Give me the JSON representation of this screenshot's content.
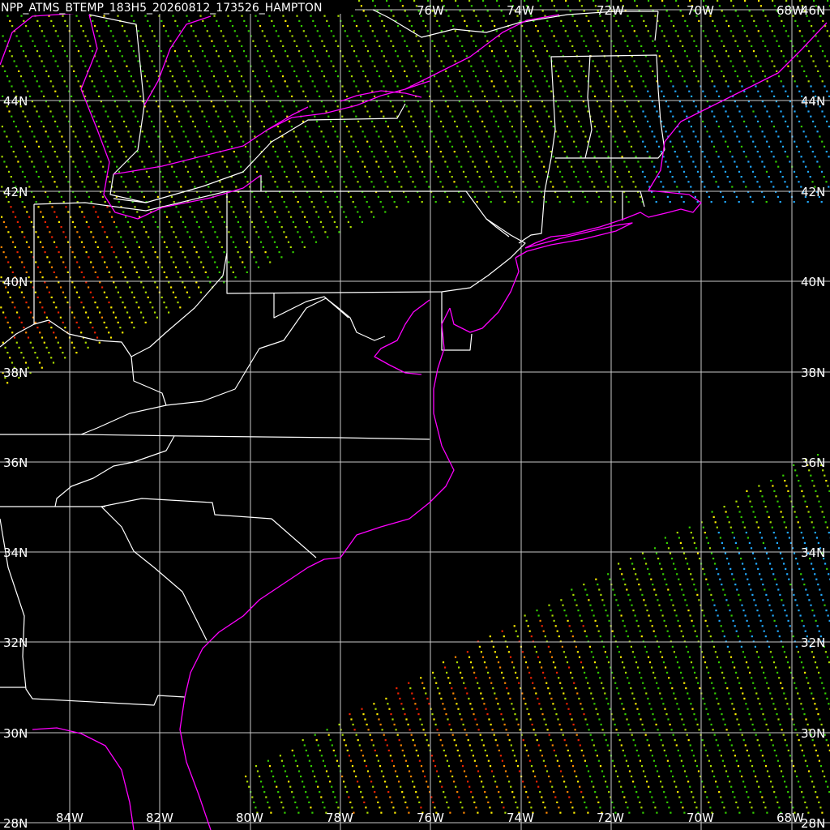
{
  "title": "NPP_ATMS_BTEMP_183H5_20260812_173526_HAMPTON",
  "lat_labels": [
    "46N",
    "44N",
    "42N",
    "40N",
    "38N",
    "36N",
    "34N",
    "32N",
    "30N",
    "28N"
  ],
  "lon_labels": [
    "84W",
    "82W",
    "80W",
    "78W",
    "76W",
    "74W",
    "72W",
    "70W",
    "68W"
  ],
  "colors": {
    "background": "#000000",
    "grid": "#c8c8c8",
    "state_borders": "#ffffff",
    "coastline": "#ff00ff",
    "obs_green": "#33cc00",
    "obs_yellowgreen": "#aadd00",
    "obs_yellow": "#ffee00",
    "obs_orange": "#ff8800",
    "obs_red": "#ee2200",
    "obs_blue": "#22aaff"
  }
}
